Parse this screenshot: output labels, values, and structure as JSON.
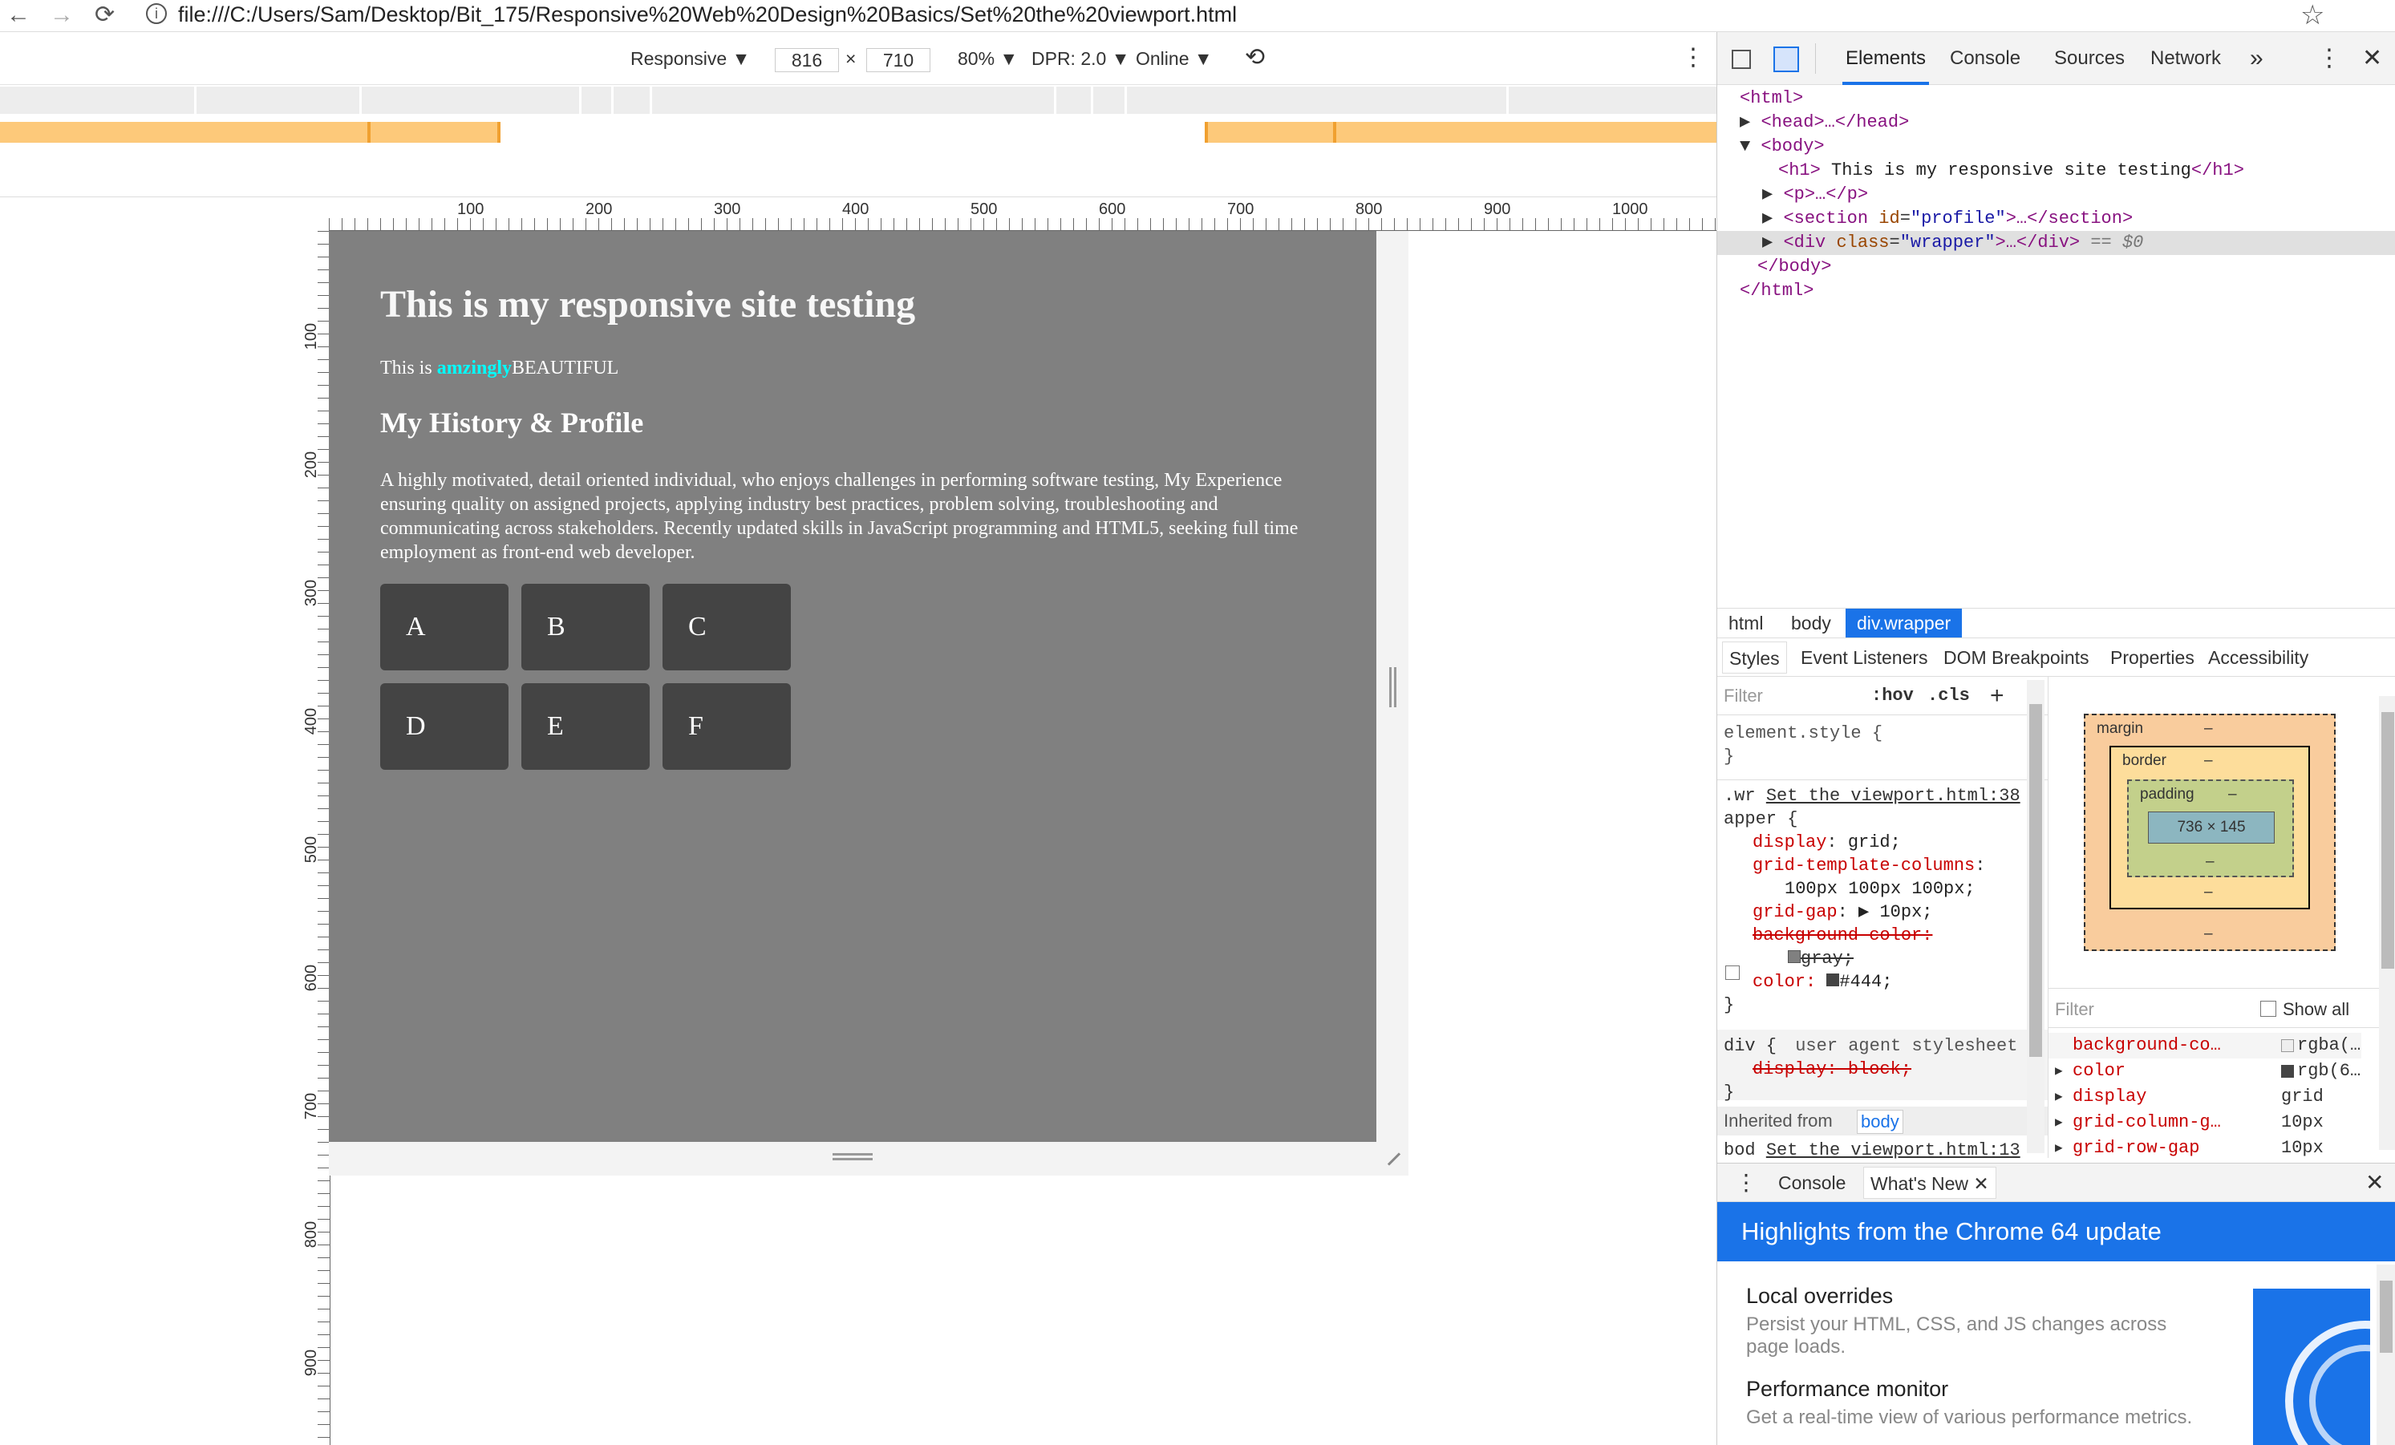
{
  "browser": {
    "back": "←",
    "forward": "→",
    "reload": "⟳",
    "url": "file:///C:/Users/Sam/Desktop/Bit_175/Responsive%20Web%20Design%20Basics/Set%20the%20viewport.html",
    "star": "☆"
  },
  "device_toolbar": {
    "mode": "Responsive ▼",
    "width": "816",
    "times": "×",
    "height": "710",
    "zoom": "80% ▼",
    "dpr": "DPR: 2.0 ▼",
    "network": "Online ▼",
    "rotate": "⟲",
    "more": "⋮"
  },
  "rulers": {
    "h_labels": [
      "100",
      "200",
      "300",
      "400",
      "500",
      "600",
      "700",
      "800",
      "900",
      "1000"
    ],
    "v_labels": [
      "100",
      "200",
      "300",
      "400",
      "500",
      "600",
      "700",
      "800",
      "900"
    ]
  },
  "page": {
    "h1": "This is my responsive site testing",
    "intro_prefix": "This is ",
    "intro_highlight": "amzingly",
    "intro_suffix": "BEAUTIFUL",
    "h2": "My History & Profile",
    "paragraph": "A highly motivated, detail oriented individual, who enjoys challenges in performing software testing, My Experience ensuring quality on assigned projects, applying industry best practices, problem solving, troubleshooting and communicating across stakeholders. Recently updated skills in JavaScript programming and HTML5, seeking full time employment as front-end web developer.",
    "tiles": [
      "A",
      "B",
      "C",
      "D",
      "E",
      "F"
    ]
  },
  "devtools": {
    "tabs": [
      "Elements",
      "Console",
      "Sources",
      "Network",
      "»"
    ],
    "dom": {
      "html_open": "<html>",
      "head": "<head>…</head>",
      "body_open": "<body>",
      "h1_text": "This is my responsive site testing",
      "p": "<p>…</p>",
      "section_id": "profile",
      "div_class": "wrapper",
      "eq": "== $0",
      "body_close": "</body>",
      "html_close": "</html>"
    },
    "breadcrumbs": [
      "html",
      "body",
      "div.wrapper"
    ],
    "subtabs": [
      "Styles",
      "Event Listeners",
      "DOM Breakpoints",
      "Properties",
      "Accessibility"
    ],
    "styles": {
      "filter_placeholder": "Filter",
      "hov": ":hov",
      "cls": ".cls",
      "plus": "+",
      "element_style": "element.style {",
      "close": "}",
      "rule_selector_a": ".wr",
      "rule_source": "Set the viewport.html:38",
      "rule_selector_b": "apper {",
      "props": [
        {
          "name": "display",
          "value": "grid;"
        },
        {
          "name": "grid-template-columns",
          "value": ""
        },
        {
          "name": "",
          "value": "100px 100px 100px;"
        },
        {
          "name": "grid-gap",
          "value": "▶ 10px;"
        }
      ],
      "bg_name": "background-color:",
      "bg_value": "gray;",
      "color_name": "color:",
      "color_value": "#444;",
      "ua_selector": "div {",
      "ua_label": "user agent stylesheet",
      "ua_prop": "display: block;",
      "inherited_label": "Inherited from",
      "inherited_from": "body",
      "body_rule": "bod",
      "body_source": "Set the viewport.html:13"
    },
    "box_model": {
      "margin": "margin",
      "border": "border",
      "padding": "padding",
      "dash": "–",
      "content": "736 × 145"
    },
    "computed": {
      "filter_placeholder": "Filter",
      "show_all": "Show all",
      "rows": [
        {
          "name": "background-co…",
          "value": "rgba(…"
        },
        {
          "name": "color",
          "value": "rgb(6…"
        },
        {
          "name": "display",
          "value": "grid"
        },
        {
          "name": "grid-column-g…",
          "value": "10px"
        },
        {
          "name": "grid-row-gap",
          "value": "10px"
        }
      ]
    },
    "drawer": {
      "tabs": [
        "Console",
        "What's New"
      ],
      "close": "✕",
      "banner": "Highlights from the Chrome 64 update",
      "items": [
        {
          "title": "Local overrides",
          "desc": "Persist your HTML, CSS, and JS changes across page loads."
        },
        {
          "title": "Performance monitor",
          "desc": "Get a real-time view of various performance metrics."
        }
      ]
    }
  }
}
